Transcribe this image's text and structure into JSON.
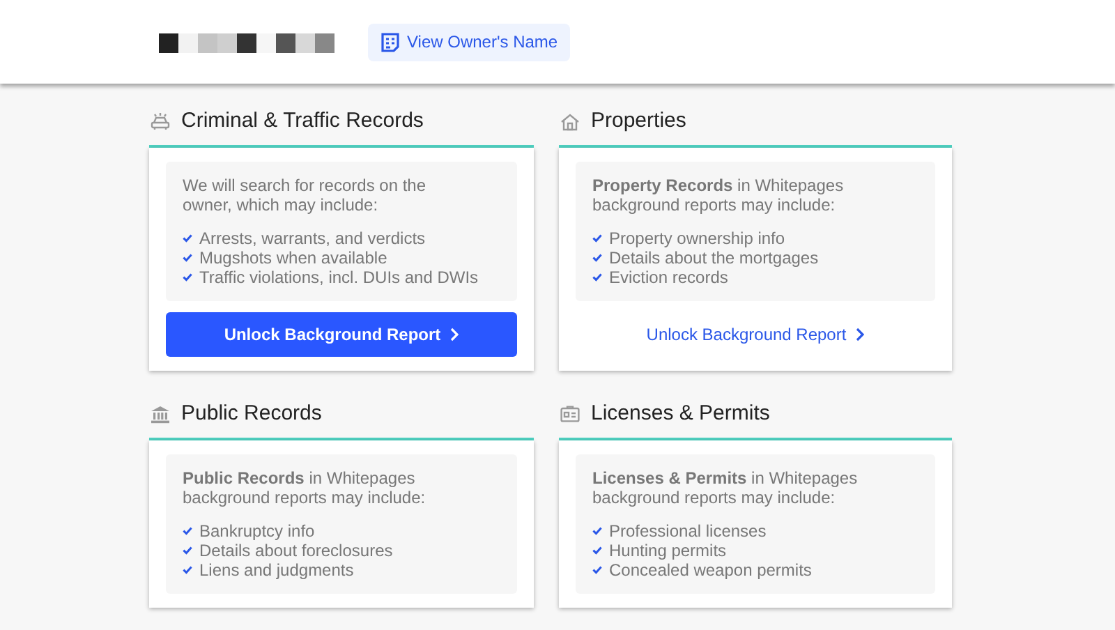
{
  "header": {
    "owner_button": "View Owner's Name"
  },
  "sections": [
    {
      "title": "Criminal & Traffic Records",
      "intro": "We will search for records on the owner, which may include:",
      "items": [
        "Arrests, warrants, and verdicts",
        "Mugshots when available",
        "Traffic violations, incl. DUIs and DWIs"
      ],
      "action": {
        "kind": "filled",
        "label": "Unlock Background Report"
      }
    },
    {
      "title": "Properties",
      "intro": "**Property Records** in Whitepages background reports may include:",
      "items": [
        "Property ownership info",
        "Details about the mortgages",
        "Eviction records"
      ],
      "action": {
        "kind": "link",
        "label": "Unlock Background Report"
      }
    },
    {
      "title": "Public Records",
      "intro": "**Public Records** in Whitepages background reports may include:",
      "items": [
        "Bankruptcy info",
        "Details about foreclosures",
        "Liens and judgments"
      ]
    },
    {
      "title": "Licenses & Permits",
      "intro": "**Licenses & Permits** in Whitepages background reports may include:",
      "items": [
        "Professional licenses",
        "Hunting permits",
        "Concealed weapon permits"
      ]
    }
  ]
}
